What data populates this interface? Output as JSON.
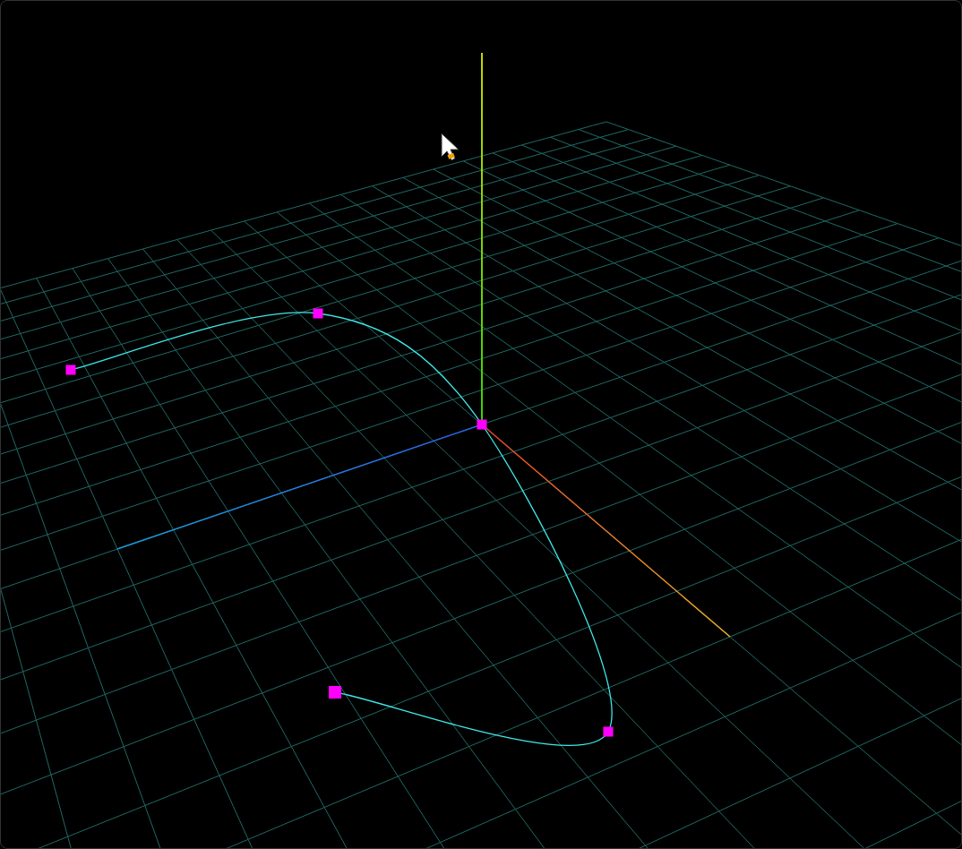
{
  "viewport": {
    "kind": "spline-editor"
  }
}
